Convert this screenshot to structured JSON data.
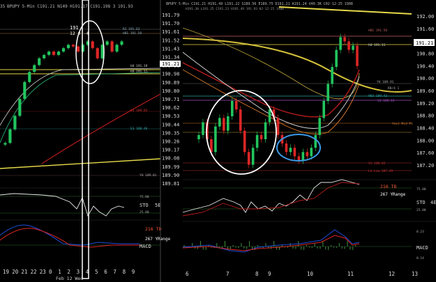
{
  "left_panel": {
    "header": "BPUPY 5-Min C191.21 N149 H191.17 C191.198 3 191.93",
    "header_prefix": "35",
    "sto_label": "STO",
    "sto_value": "5E",
    "macd_label": "MACD",
    "td_label": "216 TD",
    "yrange_label": "267 YRange",
    "annot_top": "191",
    "annot_top2": "12 0 -4",
    "level_r2": "R2 191.63",
    "level_h1": "H81 191.58",
    "level_h4a": "H4 191.19",
    "level_h4b": "H4 191.11",
    "level_s1": "S1 189.03",
    "level_e3": "E3 188.46",
    "level_yh": "YH 189.01",
    "sto_75": "75.00",
    "sto_25": "25.00",
    "x_ticks": [
      "19",
      "20",
      "21",
      "22",
      "23",
      "0",
      "1",
      "2",
      "3",
      "4",
      "5",
      "6",
      "7",
      "8",
      "9"
    ],
    "date_label": "Feb 12 Wed"
  },
  "right_panel": {
    "header": "BPUPY 5-Min C191.21 H191.49 L191.22 S189.56 E189.75 D191.21 A191.24 V40.3K C02-12-25 1908",
    "subheader": "H191.30 L191.25 C191.21 H191.49 191.93 02-12-25 1908",
    "price_box": "191.21",
    "left_price_box": "191.21",
    "sto_label": "STO",
    "sto_value": "4E",
    "macd_label": "MACD",
    "td_label": "216 TD",
    "yrange_label": "267 YRange",
    "level_h81": "H81 191.50",
    "level_h4": "H4 191.11",
    "level_yh": "YH 189.91",
    "level_r8": "R8/4 1",
    "level_h83": "H83 189.42",
    "level_s3": "S3 189.13",
    "level_yest": "Yest Mid Pt",
    "level_s1": "S1 188.03",
    "level_lh": "Lh Low 187.49",
    "left_price_ticks": [
      "191.79",
      "191.70",
      "191.61",
      "191.52",
      "191.43",
      "191.34",
      "191.21",
      "190.98",
      "190.89",
      "190.80",
      "190.71",
      "190.62",
      "190.53",
      "190.44",
      "190.35",
      "190.26",
      "190.17",
      "190.08",
      "189.99",
      "189.90",
      "189.81"
    ],
    "right_price_ticks": [
      "192.00",
      "191.60",
      "191.20",
      "190.80",
      "190.40",
      "190.00",
      "189.60",
      "189.20",
      "188.80",
      "188.40",
      "188.00",
      "187.60",
      "187.20"
    ],
    "sto_ticks": [
      "75.00",
      "25.00"
    ],
    "macd_ticks": [
      "0.23",
      "0.14"
    ],
    "x_ticks": [
      "6",
      "7",
      "8",
      "9",
      "10",
      "11",
      "12",
      "13"
    ]
  },
  "colors": {
    "background": "#000000",
    "candle_up": "#22c55e",
    "candle_down": "#dc2626",
    "ma_yellow": "#e6d94a",
    "ma_red": "#b91c1c",
    "ma_white": "#d9d9d9",
    "ma_orange": "#d97a2b",
    "circle_white": "#ffffff",
    "circle_blue": "#3b9be8",
    "td_color": "#ff5a36"
  },
  "chart_data": [
    {
      "type": "line",
      "title": "",
      "panel": "left-price",
      "series": [
        {
          "values": [
            188.2,
            188.6,
            189.0,
            189.5,
            190.0,
            190.3,
            190.5,
            190.7,
            190.8,
            190.9,
            190.8,
            190.9,
            191.0,
            191.1,
            191.05,
            190.9,
            191.1,
            191.2,
            191.0,
            190.7,
            191.1,
            191.2,
            190.9,
            191.1,
            191.2
          ]
        }
      ]
    },
    {
      "type": "line",
      "title": "",
      "panel": "right-price",
      "series": [
        {
          "values": [
            190.4,
            190.55,
            190.35,
            190.2,
            190.5,
            190.6,
            190.45,
            190.62,
            190.8,
            190.7,
            190.45,
            190.2,
            190.05,
            190.25,
            190.4,
            190.35,
            190.55,
            190.7,
            190.6,
            190.4,
            190.3,
            190.2,
            190.25,
            190.15,
            190.1,
            190.2,
            190.15,
            190.25,
            190.4,
            190.6,
            190.8,
            191.0,
            191.2,
            191.4,
            191.55,
            191.5,
            191.4,
            191.45,
            191.21
          ]
        }
      ],
      "ylim": [
        189.81,
        191.79
      ]
    }
  ]
}
